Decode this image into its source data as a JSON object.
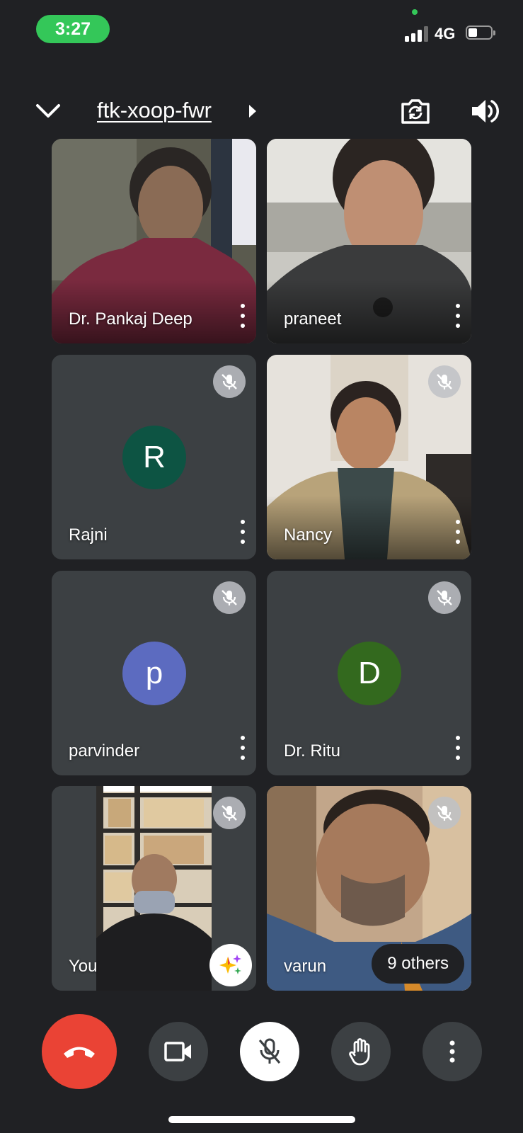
{
  "status_bar": {
    "time": "3:27",
    "network": "4G",
    "accent": "#34c759"
  },
  "header": {
    "meeting_code": "ftk-xoop-fwr",
    "icons": [
      "chevron-down-icon",
      "chevron-right-icon",
      "camera-switch-icon",
      "speaker-icon"
    ]
  },
  "participants": [
    {
      "name": "Dr. Pankaj Deep",
      "kind": "video",
      "muted": false
    },
    {
      "name": "praneet",
      "kind": "video",
      "muted": false
    },
    {
      "name": "Rajni",
      "kind": "avatar",
      "initial": "R",
      "avatar_color": "#0d5443",
      "muted": true
    },
    {
      "name": "Nancy",
      "kind": "video",
      "muted": true
    },
    {
      "name": "parvinder",
      "kind": "avatar",
      "initial": "p",
      "avatar_color": "#5c6bc0",
      "muted": true
    },
    {
      "name": "Dr. Ritu",
      "kind": "avatar",
      "initial": "D",
      "avatar_color": "#33691e",
      "muted": true
    },
    {
      "name": "You",
      "kind": "video",
      "muted": true,
      "effects_button": true
    },
    {
      "name": "varun",
      "kind": "video",
      "muted": true,
      "others_label": "9 others"
    }
  ],
  "controls": {
    "buttons": [
      "end-call-button",
      "camera-toggle-button",
      "mic-toggle-button",
      "raise-hand-button",
      "more-options-button"
    ],
    "end_call_color": "#ea4335"
  }
}
